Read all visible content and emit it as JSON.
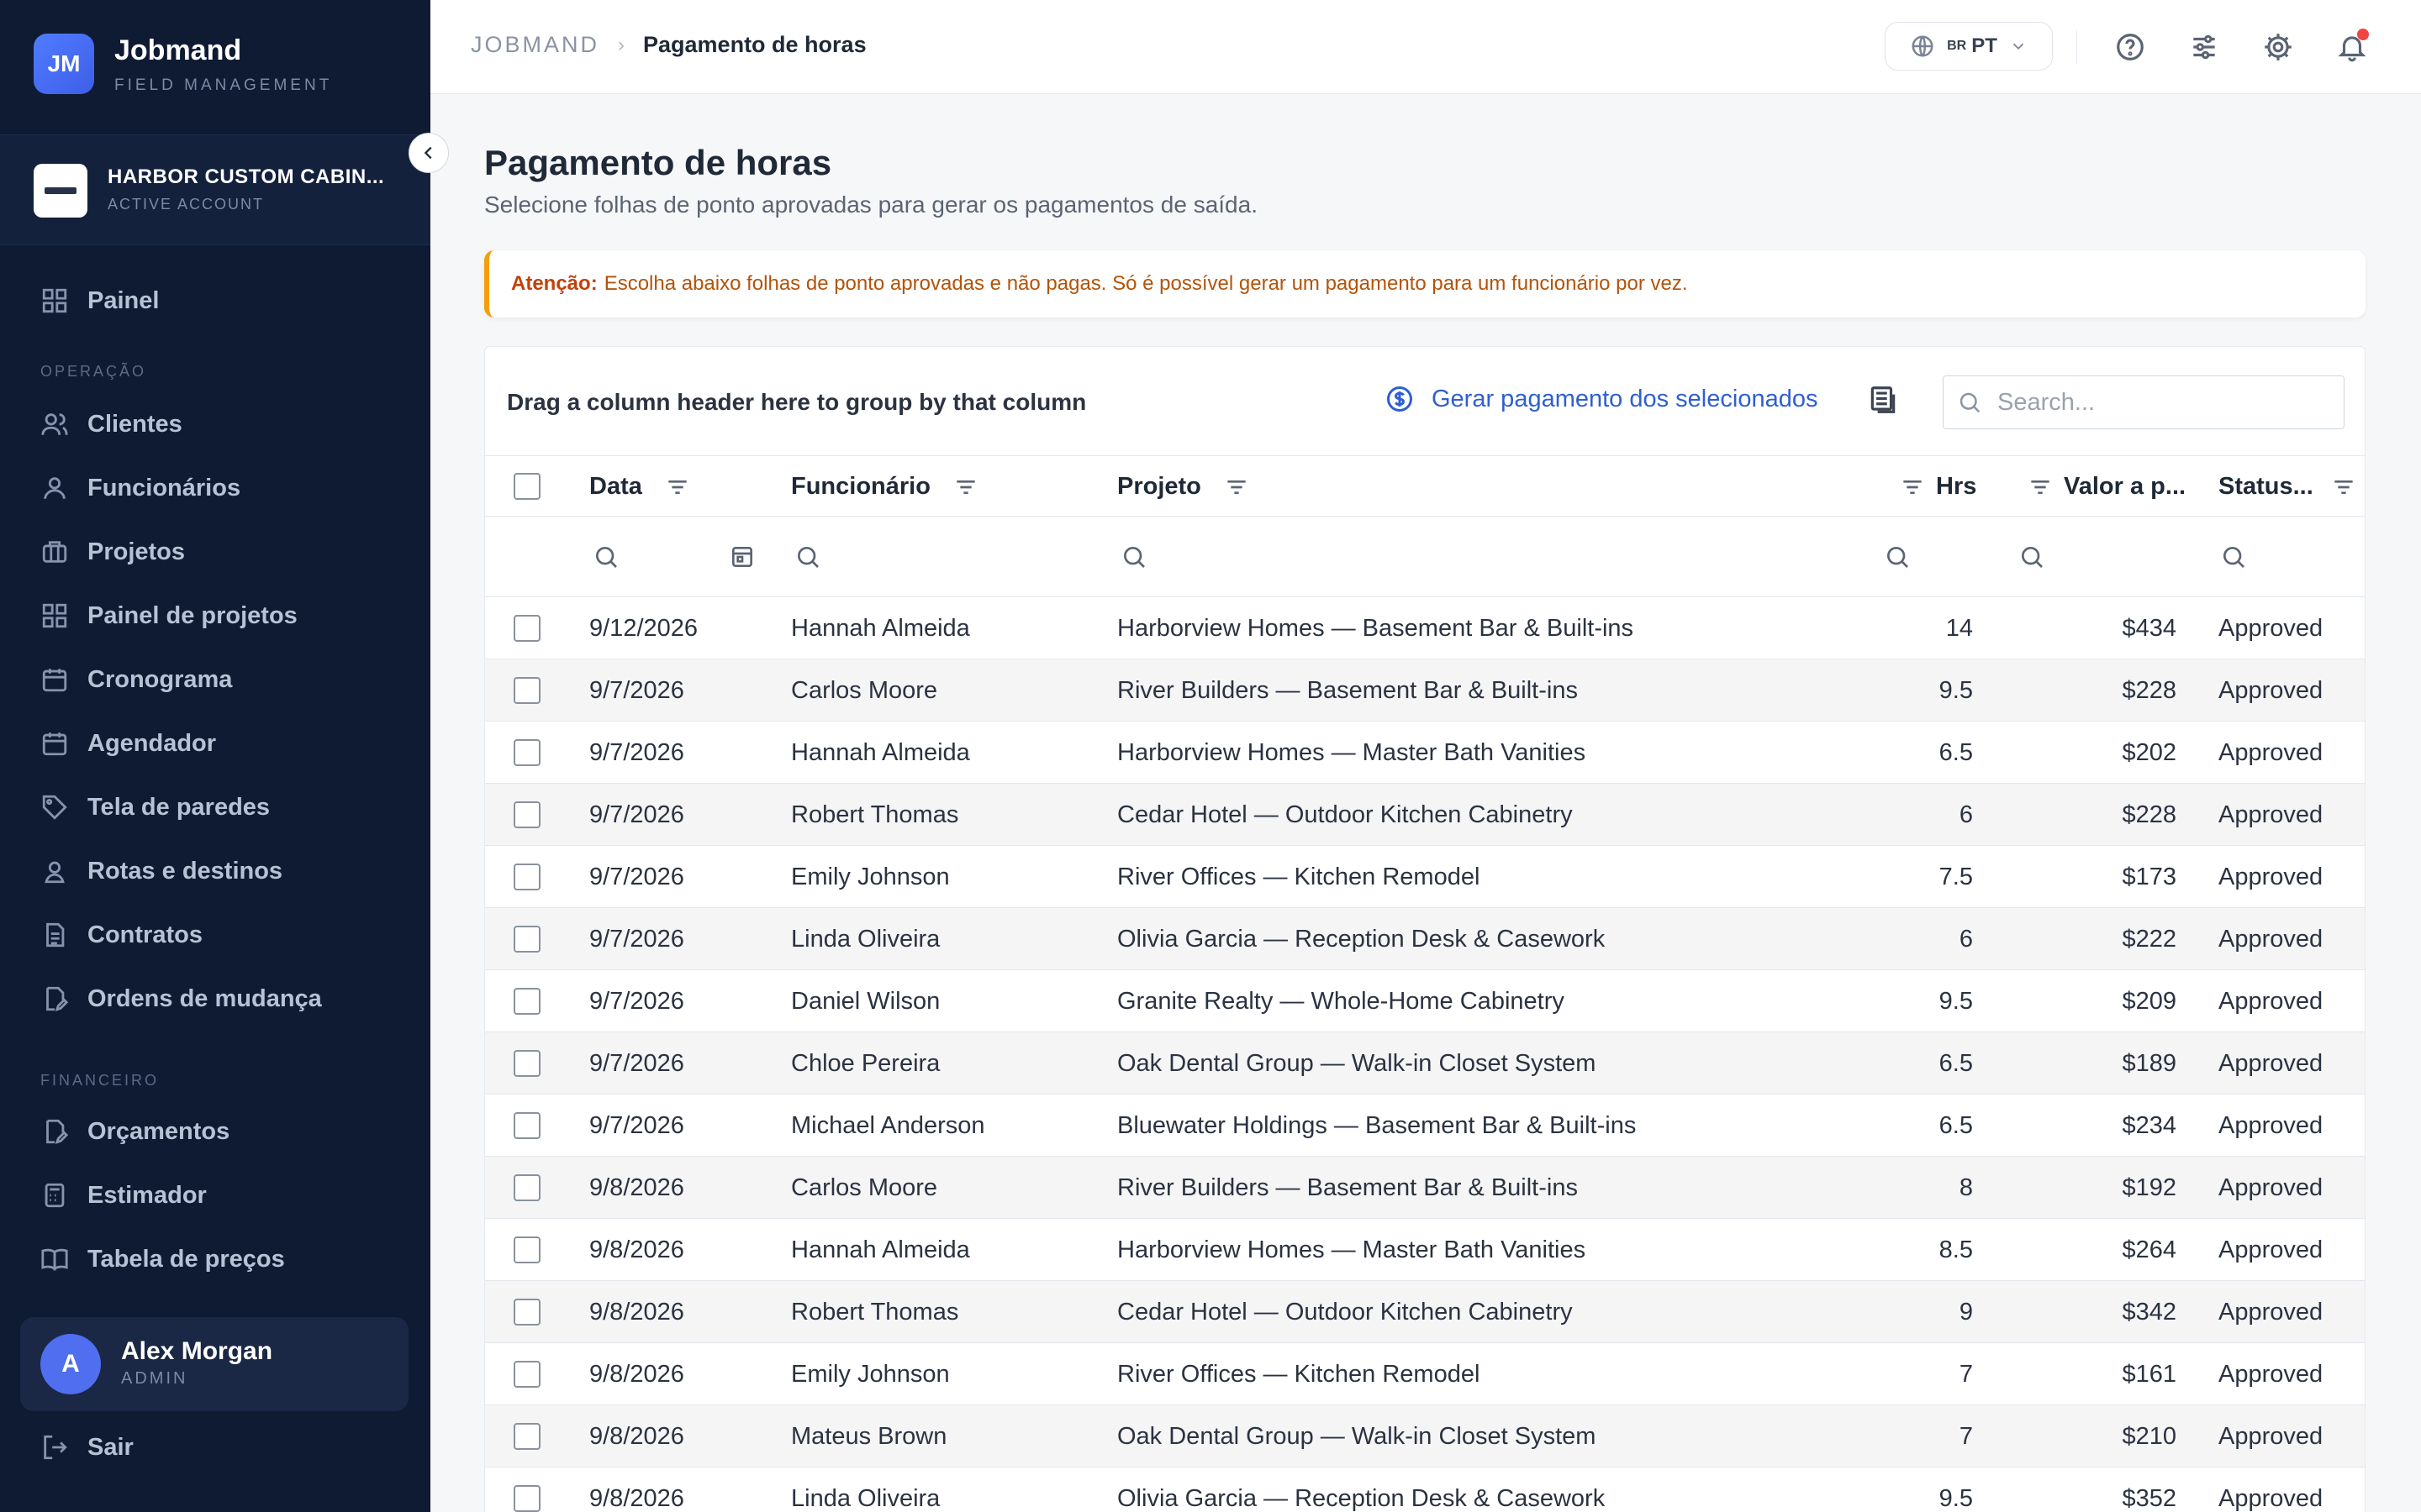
{
  "brand": {
    "initials": "JM",
    "name": "Jobmand",
    "subtitle": "FIELD MANAGEMENT"
  },
  "account": {
    "name": "HARBOR CUSTOM CABIN...",
    "status": "ACTIVE ACCOUNT"
  },
  "nav": {
    "top": [
      {
        "label": "Painel",
        "icon": "dashboard-icon"
      }
    ],
    "operacao_title": "OPERAÇÃO",
    "operacao": [
      {
        "label": "Clientes",
        "icon": "users-icon"
      },
      {
        "label": "Funcionários",
        "icon": "user-icon"
      },
      {
        "label": "Projetos",
        "icon": "briefcase-icon"
      },
      {
        "label": "Painel de projetos",
        "icon": "grid-icon"
      },
      {
        "label": "Cronograma",
        "icon": "calendar-icon"
      },
      {
        "label": "Agendador",
        "icon": "calendar-icon"
      },
      {
        "label": "Tela de paredes",
        "icon": "tag-icon"
      },
      {
        "label": "Rotas e destinos",
        "icon": "route-icon"
      },
      {
        "label": "Contratos",
        "icon": "document-icon"
      },
      {
        "label": "Ordens de mudança",
        "icon": "document-edit-icon"
      }
    ],
    "financeiro_title": "FINANCEIRO",
    "financeiro": [
      {
        "label": "Orçamentos",
        "icon": "document-edit-icon"
      },
      {
        "label": "Estimador",
        "icon": "calculator-icon"
      },
      {
        "label": "Tabela de preços",
        "icon": "book-icon"
      }
    ]
  },
  "user": {
    "initial": "A",
    "name": "Alex Morgan",
    "role": "ADMIN"
  },
  "logout_label": "Sair",
  "breadcrumb": {
    "root": "JOBMAND",
    "separator": "›",
    "current": "Pagamento de horas"
  },
  "language": {
    "flag": "BR",
    "code": "PT"
  },
  "page": {
    "title": "Pagamento de horas",
    "subtitle": "Selecione folhas de ponto aprovadas para gerar os pagamentos de saída."
  },
  "alert": {
    "label": "Atenção:",
    "text": "Escolha abaixo folhas de ponto aprovadas e não pagas. Só é possível gerar um pagamento para um funcionário por vez."
  },
  "grid": {
    "group_panel_text": "Drag a column header here to group by that column",
    "generate_label": "Gerar pagamento dos selecionados",
    "search_placeholder": "Search...",
    "columns": {
      "data": "Data",
      "funcionario": "Funcionário",
      "projeto": "Projeto",
      "hrs": "Hrs",
      "valor": "Valor a p...",
      "status": "Status..."
    },
    "rows": [
      {
        "data": "9/12/2026",
        "funcionario": "Hannah Almeida",
        "projeto": "Harborview Homes — Basement Bar & Built-ins",
        "hrs": "14",
        "valor": "$434",
        "status": "Approved"
      },
      {
        "data": "9/7/2026",
        "funcionario": "Carlos Moore",
        "projeto": "River Builders — Basement Bar & Built-ins",
        "hrs": "9.5",
        "valor": "$228",
        "status": "Approved"
      },
      {
        "data": "9/7/2026",
        "funcionario": "Hannah Almeida",
        "projeto": "Harborview Homes — Master Bath Vanities",
        "hrs": "6.5",
        "valor": "$202",
        "status": "Approved"
      },
      {
        "data": "9/7/2026",
        "funcionario": "Robert Thomas",
        "projeto": "Cedar Hotel — Outdoor Kitchen Cabinetry",
        "hrs": "6",
        "valor": "$228",
        "status": "Approved"
      },
      {
        "data": "9/7/2026",
        "funcionario": "Emily Johnson",
        "projeto": "River Offices — Kitchen Remodel",
        "hrs": "7.5",
        "valor": "$173",
        "status": "Approved"
      },
      {
        "data": "9/7/2026",
        "funcionario": "Linda Oliveira",
        "projeto": "Olivia Garcia — Reception Desk & Casework",
        "hrs": "6",
        "valor": "$222",
        "status": "Approved"
      },
      {
        "data": "9/7/2026",
        "funcionario": "Daniel Wilson",
        "projeto": "Granite Realty — Whole-Home Cabinetry",
        "hrs": "9.5",
        "valor": "$209",
        "status": "Approved"
      },
      {
        "data": "9/7/2026",
        "funcionario": "Chloe Pereira",
        "projeto": "Oak Dental Group — Walk-in Closet System",
        "hrs": "6.5",
        "valor": "$189",
        "status": "Approved"
      },
      {
        "data": "9/7/2026",
        "funcionario": "Michael Anderson",
        "projeto": "Bluewater Holdings — Basement Bar & Built-ins",
        "hrs": "6.5",
        "valor": "$234",
        "status": "Approved"
      },
      {
        "data": "9/8/2026",
        "funcionario": "Carlos Moore",
        "projeto": "River Builders — Basement Bar & Built-ins",
        "hrs": "8",
        "valor": "$192",
        "status": "Approved"
      },
      {
        "data": "9/8/2026",
        "funcionario": "Hannah Almeida",
        "projeto": "Harborview Homes — Master Bath Vanities",
        "hrs": "8.5",
        "valor": "$264",
        "status": "Approved"
      },
      {
        "data": "9/8/2026",
        "funcionario": "Robert Thomas",
        "projeto": "Cedar Hotel — Outdoor Kitchen Cabinetry",
        "hrs": "9",
        "valor": "$342",
        "status": "Approved"
      },
      {
        "data": "9/8/2026",
        "funcionario": "Emily Johnson",
        "projeto": "River Offices — Kitchen Remodel",
        "hrs": "7",
        "valor": "$161",
        "status": "Approved"
      },
      {
        "data": "9/8/2026",
        "funcionario": "Mateus Brown",
        "projeto": "Oak Dental Group — Walk-in Closet System",
        "hrs": "7",
        "valor": "$210",
        "status": "Approved"
      },
      {
        "data": "9/8/2026",
        "funcionario": "Linda Oliveira",
        "projeto": "Olivia Garcia — Reception Desk & Casework",
        "hrs": "9.5",
        "valor": "$352",
        "status": "Approved"
      }
    ]
  },
  "colors": {
    "sidebar_bg": "#0f1b33",
    "accent": "#2f5fd0",
    "alert_border": "#f59e0b",
    "alert_text": "#b45309",
    "notification_dot": "#ef4444"
  }
}
